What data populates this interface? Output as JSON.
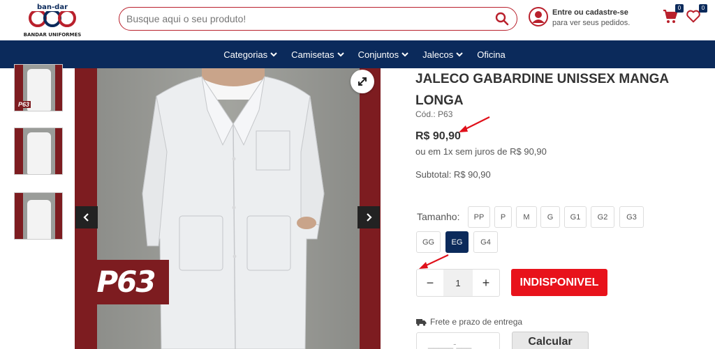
{
  "header": {
    "logo_brand": "ban-dar",
    "logo_subtitle": "BANDAR UNIFORMES",
    "search_placeholder": "Busque aqui o seu produto!",
    "account_line1": "Entre ou cadastre-se",
    "account_line2": "para ver seus pedidos.",
    "cart_count": "0",
    "wishlist_count": "0"
  },
  "nav": {
    "items": [
      {
        "label": "Categorias",
        "dropdown": true
      },
      {
        "label": "Camisetas",
        "dropdown": true
      },
      {
        "label": "Conjuntos",
        "dropdown": true
      },
      {
        "label": "Jalecos",
        "dropdown": true
      },
      {
        "label": "Oficina",
        "dropdown": false
      }
    ]
  },
  "gallery": {
    "thumb_label": "P63",
    "image_label": "P63"
  },
  "product": {
    "title": "JALECO GABARDINE UNISSEX MANGA LONGA",
    "code": "Cód.: P63",
    "price": "R$ 90,90",
    "installments": "ou em 1x sem juros de R$ 90,90",
    "subtotal": "Subtotal: R$ 90,90",
    "size_label": "Tamanho:",
    "sizes": [
      "PP",
      "P",
      "M",
      "G",
      "G1",
      "G2",
      "G3",
      "GG",
      "EG",
      "G4"
    ],
    "selected_size": "EG",
    "quantity": "1",
    "qty_minus": "−",
    "qty_plus": "+",
    "unavailable_label": "INDISPONIVEL",
    "shipping_label": "Frete e prazo de entrega",
    "cep_placeholder": "_____-___",
    "calculate_label": "Calcular"
  },
  "colors": {
    "brand_red": "#b9202c",
    "navy": "#0b2a5b",
    "button_red": "#e8121b",
    "backdrop_maroon": "#7d1c20"
  }
}
